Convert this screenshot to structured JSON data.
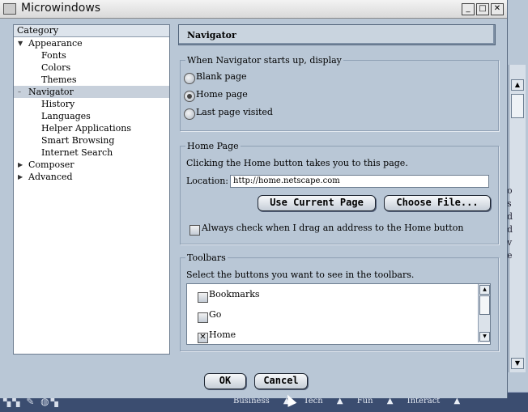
{
  "window": {
    "title": "Microwindows"
  },
  "category": {
    "header": "Category",
    "items": [
      {
        "label": "Appearance",
        "level": 0,
        "twisty": "▼"
      },
      {
        "label": "Fonts",
        "level": 1
      },
      {
        "label": "Colors",
        "level": 1
      },
      {
        "label": "Themes",
        "level": 1
      },
      {
        "label": "Navigator",
        "level": 0,
        "twisty": "–",
        "selected": true
      },
      {
        "label": "History",
        "level": 1
      },
      {
        "label": "Languages",
        "level": 1
      },
      {
        "label": "Helper Applications",
        "level": 1
      },
      {
        "label": "Smart Browsing",
        "level": 1
      },
      {
        "label": "Internet Search",
        "level": 1
      },
      {
        "label": "Composer",
        "level": 0,
        "twisty": "▶"
      },
      {
        "label": "Advanced",
        "level": 0,
        "twisty": "▶"
      }
    ]
  },
  "panel": {
    "title": "Navigator"
  },
  "startup": {
    "legend": "When Navigator starts up, display",
    "options": [
      "Blank page",
      "Home page",
      "Last page visited"
    ],
    "selected_index": 1
  },
  "homepage": {
    "legend": "Home Page",
    "description": "Clicking the Home button takes you to this page.",
    "location_label": "Location:",
    "location_value": "http://home.netscape.com",
    "use_current_label": "Use Current Page",
    "choose_file_label": "Choose File...",
    "always_check_label": "Always check when I drag an address to the Home button",
    "always_check_checked": false
  },
  "toolbars": {
    "legend": "Toolbars",
    "description": "Select the buttons you want to see in the toolbars.",
    "items": [
      {
        "label": "Bookmarks",
        "checked": false
      },
      {
        "label": "Go",
        "checked": false
      },
      {
        "label": "Home",
        "checked": true
      }
    ]
  },
  "dialog": {
    "ok_label": "OK",
    "cancel_label": "Cancel"
  },
  "taskbar": {
    "menus": [
      "Business",
      "Tech",
      "Fun",
      "Interact"
    ]
  },
  "background": {
    "side_text": "o\ns\nd\nd\nv\ne"
  }
}
